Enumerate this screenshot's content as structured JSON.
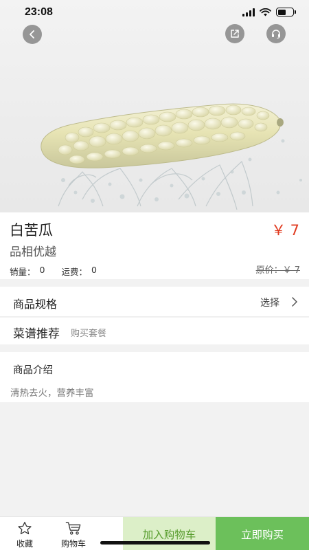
{
  "status_bar": {
    "time": "23:08",
    "battery_level": 0.55
  },
  "icons": {
    "back": "back-arrow-icon",
    "share": "share-icon",
    "service": "headset-icon",
    "favorite": "star-icon",
    "cart": "cart-icon",
    "chevron": "chevron-right-icon"
  },
  "product": {
    "name": "白苦瓜",
    "price": "￥ 7",
    "tagline": "品相优越",
    "sales_label": "销量：",
    "sales_value": "0",
    "shipping_label": "运费：",
    "shipping_value": "0",
    "original_price": "原价：￥ 7"
  },
  "spec": {
    "label": "商品规格",
    "action": "选择"
  },
  "recipe": {
    "label": "菜谱推荐",
    "sub": "购买套餐"
  },
  "intro": {
    "title": "商品介绍",
    "text": "清热去火，营养丰富"
  },
  "bottom_bar": {
    "favorite_label": "收藏",
    "cart_label": "购物车",
    "add_to_cart": "加入购物车",
    "buy_now": "立即购买"
  },
  "colors": {
    "price_red": "#e03a1f",
    "add_bg": "#dcefc8",
    "add_text": "#5a9e30",
    "buy_bg": "#6cc05b"
  }
}
